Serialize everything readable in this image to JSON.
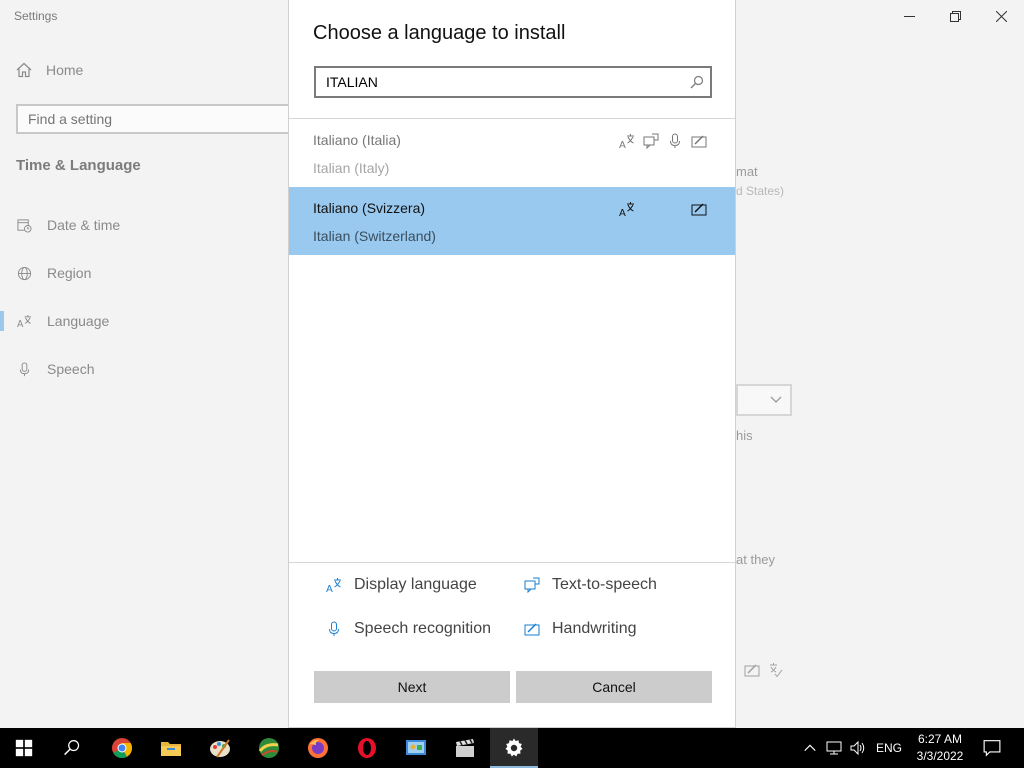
{
  "window": {
    "title": "Settings"
  },
  "sidebar": {
    "home_label": "Home",
    "search_placeholder": "Find a setting",
    "section_title": "Time & Language",
    "items": [
      {
        "label": "Date & time",
        "icon": "calendar-clock-icon"
      },
      {
        "label": "Region",
        "icon": "globe-icon"
      },
      {
        "label": "Language",
        "icon": "language-icon",
        "active": true
      },
      {
        "label": "Speech",
        "icon": "microphone-icon"
      }
    ]
  },
  "background_text": {
    "format_fragment": "mat",
    "region_fragment": "d States)",
    "this_fragment": "his",
    "they_fragment": "at they"
  },
  "dialog": {
    "title": "Choose a language to install",
    "search_value": "ITALIAN",
    "languages": [
      {
        "name": "Italiano (Italia)",
        "subtitle": "Italian (Italy)",
        "features": [
          "display-language",
          "text-to-speech",
          "speech-recognition",
          "handwriting"
        ],
        "selected": false
      },
      {
        "name": "Italiano (Svizzera)",
        "subtitle": "Italian (Switzerland)",
        "features": [
          "display-language",
          "handwriting"
        ],
        "selected": true
      }
    ],
    "legend": {
      "display_language": "Display language",
      "text_to_speech": "Text-to-speech",
      "speech_recognition": "Speech recognition",
      "handwriting": "Handwriting"
    },
    "next_label": "Next",
    "cancel_label": "Cancel"
  },
  "taskbar": {
    "apps": [
      "start",
      "search",
      "chrome",
      "file-explorer",
      "paint",
      "maps",
      "firefox",
      "opera",
      "control-panel",
      "video-editor",
      "settings"
    ],
    "active_app": "settings",
    "tray": {
      "language": "ENG",
      "time": "6:27 AM",
      "date": "3/3/2022"
    }
  },
  "colors": {
    "selection": "#99c9ef",
    "accent": "#1a7fd0",
    "taskbar": "#000000"
  }
}
